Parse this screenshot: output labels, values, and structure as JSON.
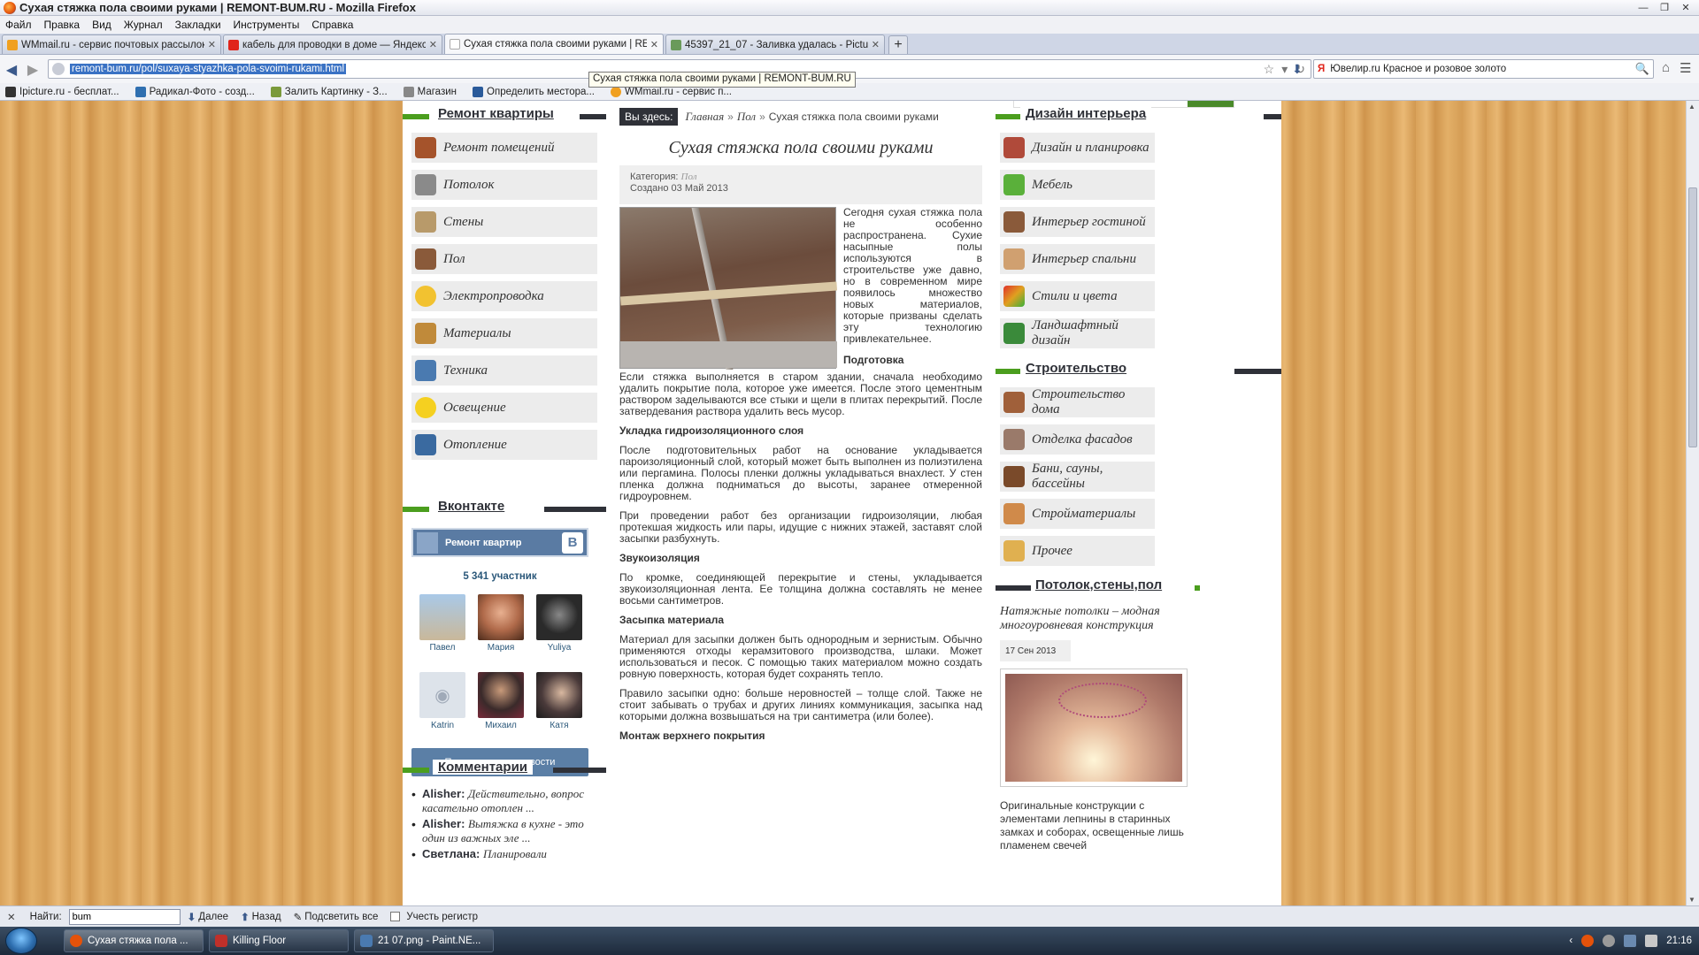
{
  "window": {
    "title": "Сухая стяжка пола своими руками | REMONT-BUM.RU - Mozilla Firefox",
    "controls": [
      "—",
      "❐",
      "✕"
    ]
  },
  "menu": [
    "Файл",
    "Правка",
    "Вид",
    "Журнал",
    "Закладки",
    "Инструменты",
    "Справка"
  ],
  "tabs": [
    {
      "label": "WMmail.ru - сервис почтовых рассылок...",
      "color": "#f0a020",
      "active": false
    },
    {
      "label": "кабель для проводки в доме — Яндекс...",
      "color": "#e0241b",
      "active": false
    },
    {
      "label": "Сухая стяжка пола своими руками | RE...",
      "color": "#ffffff",
      "active": true
    },
    {
      "label": "45397_21_07 - Заливка удалась - Pictu...",
      "color": "#6a9a5a",
      "active": false
    }
  ],
  "newtab": "+",
  "nav": {
    "url": "remont-bum.ru/pol/suxaya-styazhka-pola-svoimi-rukami.html",
    "search_value": "Ювелир.ru Красное и розовое золото",
    "search_engine": "Я",
    "tooltip": "Сухая стяжка пола своими руками | REMONT-BUM.RU"
  },
  "bookmarks": [
    {
      "label": "Ipicture.ru - бесплат...",
      "color": "#333333"
    },
    {
      "label": "Радикал-Фото - созд...",
      "color": "#2f6fb0"
    },
    {
      "label": "Залить Картинку - З...",
      "color": "#7a9a3a"
    },
    {
      "label": "Магазин",
      "color": "#888888"
    },
    {
      "label": "Определить местора...",
      "color": "#2a5a9a"
    },
    {
      "label": "WMmail.ru - сервис п...",
      "color": "#f0a020"
    }
  ],
  "left": {
    "heading1": "Ремонт квартиры",
    "items": [
      {
        "label": "Ремонт помещений",
        "color": "#a5532b"
      },
      {
        "label": "Потолок",
        "color": "#8a8a8a"
      },
      {
        "label": "Стены",
        "color": "#b89a6a"
      },
      {
        "label": "Пол",
        "color": "#8a5a3a"
      },
      {
        "label": "Электропроводка",
        "color": "#f2c230"
      },
      {
        "label": "Материалы",
        "color": "#c08a3a"
      },
      {
        "label": "Техника",
        "color": "#4a7ab0"
      },
      {
        "label": "Освещение",
        "color": "#f5d020"
      },
      {
        "label": "Отопление",
        "color": "#3a6aa0"
      }
    ],
    "heading2": "Вконтакте",
    "vk": {
      "group": "Ремонт квартир",
      "badge": "B",
      "count": "5 341 участник",
      "people": [
        {
          "name": "Павел",
          "color": "#c9b89a"
        },
        {
          "name": "Мария",
          "color": "#b06a4a"
        },
        {
          "name": "Yuliya",
          "color": "#2a2a2a"
        },
        {
          "name": "Katrin",
          "color": "#dde3ea"
        },
        {
          "name": "Михаил",
          "color": "#3a2a2a"
        },
        {
          "name": "Катя",
          "color": "#4a3a3a"
        }
      ],
      "subscribe": "Подписаться на новости"
    },
    "heading3": "Комментарии",
    "comments": [
      {
        "author": "Alisher:",
        "text": "Действительно, вопрос касательно отоплен ..."
      },
      {
        "author": "Alisher:",
        "text": "Вытяжка в кухне - это один из важных эле ..."
      },
      {
        "author": "Светлана:",
        "text": "Планировали"
      }
    ]
  },
  "main": {
    "here_label": "Вы здесь:",
    "crumb_home": "Главная",
    "crumb_sep": "»",
    "crumb_section": "Пол",
    "crumb_current": "Сухая стяжка пола своими руками",
    "title": "Сухая стяжка пола своими руками",
    "category_label": "Категория:",
    "category": "Пол",
    "created": "Создано 03 Май 2013",
    "intro": "Сегодня сухая стяжка пола не особенно распространена. Сухие насыпные полы используются в строительстве уже давно, но в современном мире появилось множество новых материалов, которые призваны сделать эту технологию привлекательнее.",
    "h_prep": "Подготовка",
    "p_prep": "Если стяжка выполняется в старом здании, сначала необходимо удалить покрытие пола, которое уже имеется. После этого цементным раствором заделываются все стыки и щели в плитах перекрытий. После затвердевания раствора удалить весь мусор.",
    "h_hydro": "Укладка гидроизоляционного слоя",
    "p_hydro1": "После подготовительных работ на основание укладывается пароизоляционный слой, который может быть выполнен из полиэтилена или пергамина. Полосы пленки должны укладываться внахлест. У стен пленка должна подниматься до высоты, заранее отмеренной гидроуровнем.",
    "p_hydro2": "При проведении работ без организации гидроизоляции, любая протекшая жидкость или пары, идущие с нижних этажей, заставят слой засыпки разбухнуть.",
    "h_sound": "Звукоизоляция",
    "p_sound": "По кромке, соединяющей перекрытие и стены, укладывается звукоизоляционная лента. Ее толщина должна составлять не менее восьми сантиметров.",
    "h_fill": "Засыпка материала",
    "p_fill1": "Материал для засыпки должен быть однородным и зернистым. Обычно применяются отходы керамзитового производства, шлаки. Может использоваться и песок. С помощью таких материалом можно создать ровную поверхность, которая будет сохранять тепло.",
    "p_fill2": "Правило засыпки одно: больше неровностей – толще слой. Также не стоит забывать о трубах и других линиях коммуникация, засыпка над которыми должна возвышаться на три сантиметра (или более).",
    "h_top": "Монтаж верхнего покрытия"
  },
  "right": {
    "heading1": "Дизайн интерьера",
    "items1": [
      {
        "label": "Дизайн и планировка",
        "color": "#b04a3a"
      },
      {
        "label": "Мебель",
        "color": "#5ab03a"
      },
      {
        "label": "Интерьер гостиной",
        "color": "#8a5a3a"
      },
      {
        "label": "Интерьер спальни",
        "color": "#d0a070"
      },
      {
        "label": "Стили и цвета",
        "color": "#e0a020"
      },
      {
        "label": "Ландшафтный дизайн",
        "color": "#3a8a3a"
      }
    ],
    "heading2": "Строительство",
    "items2": [
      {
        "label": "Строительство дома",
        "color": "#a0603a"
      },
      {
        "label": "Отделка фасадов",
        "color": "#9a7a6a"
      },
      {
        "label": "Бани, сауны, бассейны",
        "color": "#7a4a2a"
      },
      {
        "label": "Стройматериалы",
        "color": "#d08a4a"
      },
      {
        "label": "Прочее",
        "color": "#e0b050"
      }
    ],
    "heading3": "Потолок,стены,пол",
    "news_title": "Натяжные потолки – модная многоуровневая конструкция",
    "news_date": "17 Сен 2013",
    "news_text": "Оригинальные конструкции с элементами лепнины в старинных замках и соборах, освещенные лишь пламенем свечей"
  },
  "findbar": {
    "close": "✕",
    "label": "Найти:",
    "value": "bum",
    "next": "Далее",
    "prev": "Назад",
    "highlight": "Подсветить все",
    "matchcase": "Учесть регистр"
  },
  "taskbar": {
    "tasks": [
      {
        "label": "Сухая стяжка пола ...",
        "color": "#e4520a",
        "active": true
      },
      {
        "label": "Killing Floor",
        "color": "#c0302a",
        "active": false
      },
      {
        "label": "21 07.png - Paint.NE...",
        "color": "#4a7ab0",
        "active": false
      }
    ],
    "time": "21:16"
  }
}
